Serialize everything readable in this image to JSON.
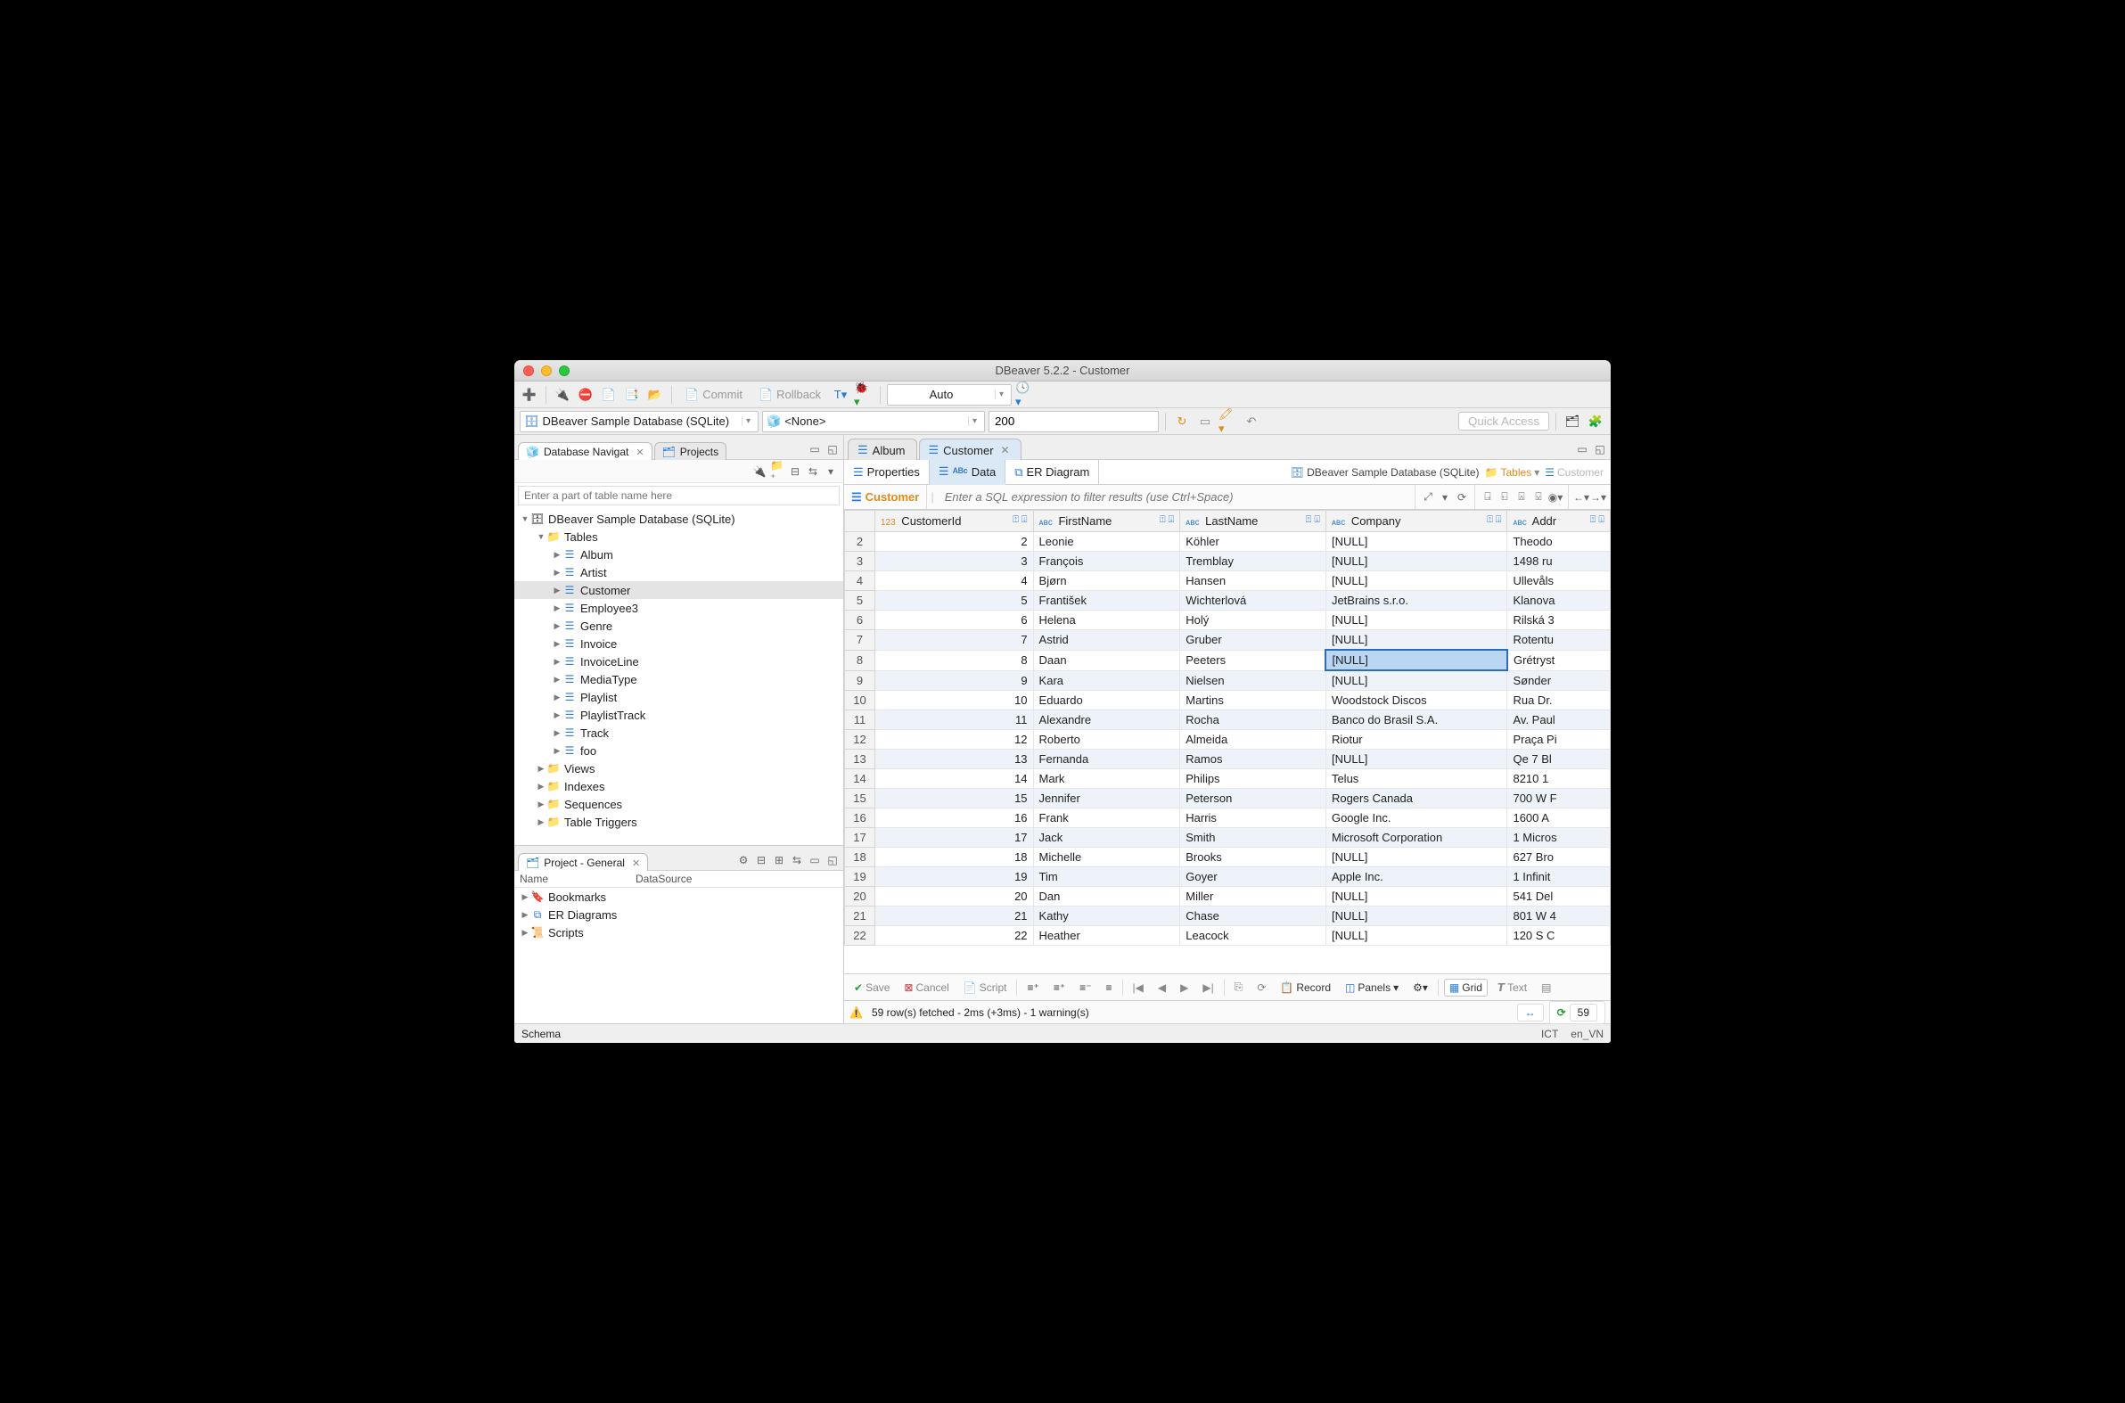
{
  "title": "DBeaver 5.2.2 - Customer",
  "toolbar1": {
    "commit": "Commit",
    "rollback": "Rollback",
    "auto": "Auto"
  },
  "toolbar2": {
    "datasource": "DBeaver Sample Database (SQLite)",
    "schema_none": "<None>",
    "limit": "200",
    "quick_access": "Quick Access"
  },
  "left_tabs": {
    "navigator": "Database Navigat",
    "projects": "Projects"
  },
  "nav_filter_placeholder": "Enter a part of table name here",
  "tree": [
    {
      "d": 0,
      "exp": true,
      "icon": "db",
      "label": "DBeaver Sample Database (SQLite)"
    },
    {
      "d": 1,
      "exp": true,
      "icon": "folder-o",
      "label": "Tables"
    },
    {
      "d": 2,
      "icon": "table",
      "label": "Album"
    },
    {
      "d": 2,
      "icon": "table",
      "label": "Artist"
    },
    {
      "d": 2,
      "icon": "table",
      "label": "Customer",
      "sel": true
    },
    {
      "d": 2,
      "icon": "table",
      "label": "Employee3"
    },
    {
      "d": 2,
      "icon": "table",
      "label": "Genre"
    },
    {
      "d": 2,
      "icon": "table",
      "label": "Invoice"
    },
    {
      "d": 2,
      "icon": "table",
      "label": "InvoiceLine"
    },
    {
      "d": 2,
      "icon": "table",
      "label": "MediaType"
    },
    {
      "d": 2,
      "icon": "table",
      "label": "Playlist"
    },
    {
      "d": 2,
      "icon": "table",
      "label": "PlaylistTrack"
    },
    {
      "d": 2,
      "icon": "table",
      "label": "Track"
    },
    {
      "d": 2,
      "icon": "table",
      "label": "foo"
    },
    {
      "d": 1,
      "icon": "folder-o",
      "label": "Views"
    },
    {
      "d": 1,
      "icon": "folder",
      "label": "Indexes"
    },
    {
      "d": 1,
      "icon": "folder",
      "label": "Sequences"
    },
    {
      "d": 1,
      "icon": "folder",
      "label": "Table Triggers"
    }
  ],
  "project": {
    "title": "Project - General",
    "cols": {
      "name": "Name",
      "ds": "DataSource"
    },
    "items": [
      {
        "icon": "bookmark",
        "label": "Bookmarks"
      },
      {
        "icon": "er",
        "label": "ER Diagrams"
      },
      {
        "icon": "script",
        "label": "Scripts"
      }
    ]
  },
  "editor_tabs": [
    {
      "label": "Album",
      "active": false
    },
    {
      "label": "Customer",
      "active": true
    }
  ],
  "sub_tabs": {
    "properties": "Properties",
    "data": "Data",
    "er": "ER Diagram"
  },
  "breadcrumb": {
    "db": "DBeaver Sample Database (SQLite)",
    "tables": "Tables",
    "table": "Customer"
  },
  "filter": {
    "table": "Customer",
    "placeholder": "Enter a SQL expression to filter results (use Ctrl+Space)"
  },
  "columns": [
    {
      "name": "CustomerId",
      "type": "num"
    },
    {
      "name": "FirstName",
      "type": "abc"
    },
    {
      "name": "LastName",
      "type": "abc"
    },
    {
      "name": "Company",
      "type": "abc"
    },
    {
      "name": "Addr",
      "type": "abc"
    }
  ],
  "rows": [
    {
      "n": 2,
      "id": 2,
      "first": "Leonie",
      "last": "Köhler",
      "company": "[NULL]",
      "addr": "Theodo"
    },
    {
      "n": 3,
      "id": 3,
      "first": "François",
      "last": "Tremblay",
      "company": "[NULL]",
      "addr": "1498 ru"
    },
    {
      "n": 4,
      "id": 4,
      "first": "Bjørn",
      "last": "Hansen",
      "company": "[NULL]",
      "addr": "Ullevåls"
    },
    {
      "n": 5,
      "id": 5,
      "first": "František",
      "last": "Wichterlová",
      "company": "JetBrains s.r.o.",
      "addr": "Klanova"
    },
    {
      "n": 6,
      "id": 6,
      "first": "Helena",
      "last": "Holý",
      "company": "[NULL]",
      "addr": "Rilská 3"
    },
    {
      "n": 7,
      "id": 7,
      "first": "Astrid",
      "last": "Gruber",
      "company": "[NULL]",
      "addr": "Rotentu"
    },
    {
      "n": 8,
      "id": 8,
      "first": "Daan",
      "last": "Peeters",
      "company": "[NULL]",
      "addr": "Grétryst",
      "sel": "company"
    },
    {
      "n": 9,
      "id": 9,
      "first": "Kara",
      "last": "Nielsen",
      "company": "[NULL]",
      "addr": "Sønder"
    },
    {
      "n": 10,
      "id": 10,
      "first": "Eduardo",
      "last": "Martins",
      "company": "Woodstock Discos",
      "addr": "Rua Dr."
    },
    {
      "n": 11,
      "id": 11,
      "first": "Alexandre",
      "last": "Rocha",
      "company": "Banco do Brasil S.A.",
      "addr": "Av. Paul"
    },
    {
      "n": 12,
      "id": 12,
      "first": "Roberto",
      "last": "Almeida",
      "company": "Riotur",
      "addr": "Praça Pi"
    },
    {
      "n": 13,
      "id": 13,
      "first": "Fernanda",
      "last": "Ramos",
      "company": "[NULL]",
      "addr": "Qe 7 Bl"
    },
    {
      "n": 14,
      "id": 14,
      "first": "Mark",
      "last": "Philips",
      "company": "Telus",
      "addr": "8210 1"
    },
    {
      "n": 15,
      "id": 15,
      "first": "Jennifer",
      "last": "Peterson",
      "company": "Rogers Canada",
      "addr": "700 W F"
    },
    {
      "n": 16,
      "id": 16,
      "first": "Frank",
      "last": "Harris",
      "company": "Google Inc.",
      "addr": "1600 A"
    },
    {
      "n": 17,
      "id": 17,
      "first": "Jack",
      "last": "Smith",
      "company": "Microsoft Corporation",
      "addr": "1 Micros"
    },
    {
      "n": 18,
      "id": 18,
      "first": "Michelle",
      "last": "Brooks",
      "company": "[NULL]",
      "addr": "627 Bro"
    },
    {
      "n": 19,
      "id": 19,
      "first": "Tim",
      "last": "Goyer",
      "company": "Apple Inc.",
      "addr": "1 Infinit"
    },
    {
      "n": 20,
      "id": 20,
      "first": "Dan",
      "last": "Miller",
      "company": "[NULL]",
      "addr": "541 Del"
    },
    {
      "n": 21,
      "id": 21,
      "first": "Kathy",
      "last": "Chase",
      "company": "[NULL]",
      "addr": "801 W 4"
    },
    {
      "n": 22,
      "id": 22,
      "first": "Heather",
      "last": "Leacock",
      "company": "[NULL]",
      "addr": "120 S C"
    }
  ],
  "grid_tools": {
    "save": "Save",
    "cancel": "Cancel",
    "script": "Script",
    "record": "Record",
    "panels": "Panels",
    "grid": "Grid",
    "text": "Text"
  },
  "status": {
    "msg": "59 row(s) fetched - 2ms (+3ms) - 1 warning(s)",
    "count": "59"
  },
  "footer": {
    "left": "Schema",
    "tz": "ICT",
    "locale": "en_VN"
  }
}
